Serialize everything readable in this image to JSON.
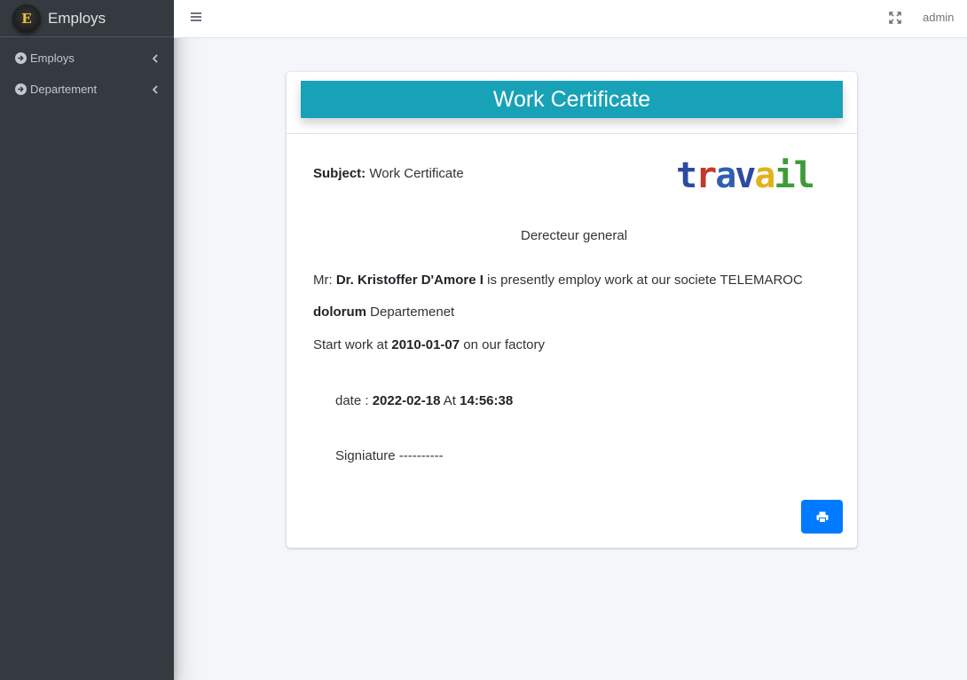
{
  "sidebar": {
    "brand_letter": "E",
    "brand_name": "Employs",
    "items": [
      {
        "label": "Employs",
        "icon": "arrow-circle-right-icon"
      },
      {
        "label": "Departement",
        "icon": "arrow-circle-right-icon"
      }
    ]
  },
  "navbar": {
    "user": "admin"
  },
  "certificate": {
    "title": "Work Certificate",
    "subject_label": "Subject:",
    "subject_value": "Work Certificate",
    "logo_text": "travail",
    "addressee": "Derecteur general",
    "mr_prefix": "Mr:",
    "employee_name": "Dr. Kristoffer D'Amore I",
    "employ_sentence": "is presently employ work at our societe TELEMAROC",
    "department_name": "dolorum",
    "department_suffix": "Departemenet",
    "start_prefix": "Start work at",
    "start_date": "2010-01-07",
    "start_suffix": "on our factory",
    "date_label": "date :",
    "date_value": "2022-02-18",
    "at_label": "At",
    "time_value": "14:56:38",
    "signature_label": "Signiature ----------"
  },
  "colors": {
    "sidebar_bg": "#343a40",
    "title_bg": "#17a2b8",
    "print_button": "#007bff"
  }
}
